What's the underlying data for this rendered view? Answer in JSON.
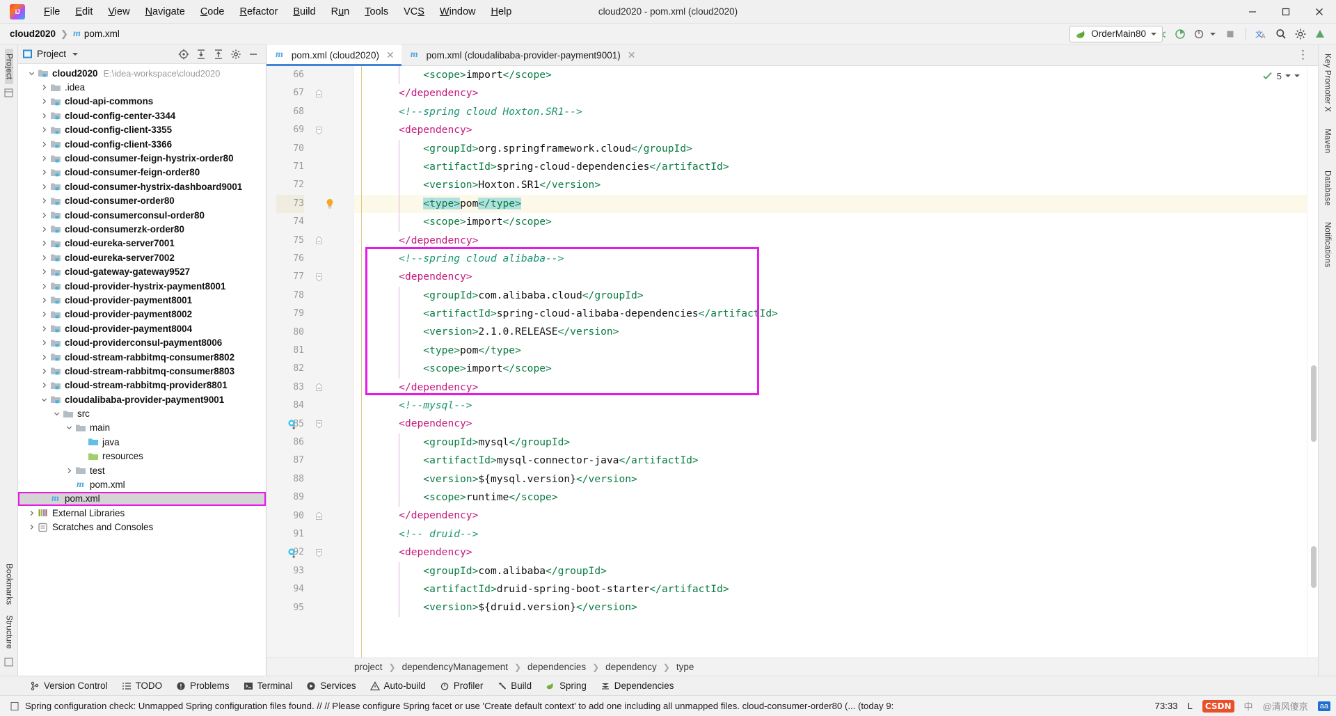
{
  "window": {
    "title": "cloud2020 - pom.xml (cloud2020)",
    "minimize": "minimize-icon",
    "maximize": "maximize-icon",
    "close": "close-icon"
  },
  "menubar": {
    "items": [
      {
        "label": "File",
        "mnemonic": "F"
      },
      {
        "label": "Edit",
        "mnemonic": "E"
      },
      {
        "label": "View",
        "mnemonic": "V"
      },
      {
        "label": "Navigate",
        "mnemonic": "N"
      },
      {
        "label": "Code",
        "mnemonic": "C"
      },
      {
        "label": "Refactor",
        "mnemonic": "R"
      },
      {
        "label": "Build",
        "mnemonic": "B"
      },
      {
        "label": "Run",
        "mnemonic": "u"
      },
      {
        "label": "Tools",
        "mnemonic": "T"
      },
      {
        "label": "VCS",
        "mnemonic": "S"
      },
      {
        "label": "Window",
        "mnemonic": "W"
      },
      {
        "label": "Help",
        "mnemonic": "H"
      }
    ]
  },
  "navbar": {
    "project": "cloud2020",
    "file": "pom.xml",
    "run_config": "OrderMain80",
    "icons": [
      "user-dropdown-icon",
      "hammer-icon",
      "run-icon",
      "debug-icon",
      "run-with-coverage-icon",
      "profiler-icon",
      "stop-icon",
      "translate-icon",
      "search-icon",
      "settings-icon",
      "updates-icon"
    ]
  },
  "left_strip": {
    "top_label": "Project",
    "bottom_labels": [
      "Bookmarks",
      "Structure"
    ]
  },
  "right_strip": {
    "labels": [
      "Key Promoter X",
      "Maven",
      "Database",
      "Notifications"
    ]
  },
  "project_panel": {
    "title": "Project",
    "toolbar_icons": [
      "locate-icon",
      "expand-all-icon",
      "collapse-all-icon",
      "settings-icon",
      "hide-icon"
    ],
    "tree": [
      {
        "depth": 0,
        "label": "cloud2020",
        "path": "E:\\idea-workspace\\cloud2020",
        "icon": "module-icon",
        "state": "expanded",
        "bold": true
      },
      {
        "depth": 1,
        "label": ".idea",
        "icon": "folder-icon",
        "state": "collapsed",
        "bold": false
      },
      {
        "depth": 1,
        "label": "cloud-api-commons",
        "icon": "module-icon",
        "state": "collapsed",
        "bold": true
      },
      {
        "depth": 1,
        "label": "cloud-config-center-3344",
        "icon": "module-icon",
        "state": "collapsed",
        "bold": true
      },
      {
        "depth": 1,
        "label": "cloud-config-client-3355",
        "icon": "module-icon",
        "state": "collapsed",
        "bold": true
      },
      {
        "depth": 1,
        "label": "cloud-config-client-3366",
        "icon": "module-icon",
        "state": "collapsed",
        "bold": true
      },
      {
        "depth": 1,
        "label": "cloud-consumer-feign-hystrix-order80",
        "icon": "module-icon",
        "state": "collapsed",
        "bold": true
      },
      {
        "depth": 1,
        "label": "cloud-consumer-feign-order80",
        "icon": "module-icon",
        "state": "collapsed",
        "bold": true
      },
      {
        "depth": 1,
        "label": "cloud-consumer-hystrix-dashboard9001",
        "icon": "module-icon",
        "state": "collapsed",
        "bold": true
      },
      {
        "depth": 1,
        "label": "cloud-consumer-order80",
        "icon": "module-icon",
        "state": "collapsed",
        "bold": true
      },
      {
        "depth": 1,
        "label": "cloud-consumerconsul-order80",
        "icon": "module-icon",
        "state": "collapsed",
        "bold": true
      },
      {
        "depth": 1,
        "label": "cloud-consumerzk-order80",
        "icon": "module-icon",
        "state": "collapsed",
        "bold": true
      },
      {
        "depth": 1,
        "label": "cloud-eureka-server7001",
        "icon": "module-icon",
        "state": "collapsed",
        "bold": true
      },
      {
        "depth": 1,
        "label": "cloud-eureka-server7002",
        "icon": "module-icon",
        "state": "collapsed",
        "bold": true
      },
      {
        "depth": 1,
        "label": "cloud-gateway-gateway9527",
        "icon": "module-icon",
        "state": "collapsed",
        "bold": true
      },
      {
        "depth": 1,
        "label": "cloud-provider-hystrix-payment8001",
        "icon": "module-icon",
        "state": "collapsed",
        "bold": true
      },
      {
        "depth": 1,
        "label": "cloud-provider-payment8001",
        "icon": "module-icon",
        "state": "collapsed",
        "bold": true
      },
      {
        "depth": 1,
        "label": "cloud-provider-payment8002",
        "icon": "module-icon",
        "state": "collapsed",
        "bold": true
      },
      {
        "depth": 1,
        "label": "cloud-provider-payment8004",
        "icon": "module-icon",
        "state": "collapsed",
        "bold": true
      },
      {
        "depth": 1,
        "label": "cloud-providerconsul-payment8006",
        "icon": "module-icon",
        "state": "collapsed",
        "bold": true
      },
      {
        "depth": 1,
        "label": "cloud-stream-rabbitmq-consumer8802",
        "icon": "module-icon",
        "state": "collapsed",
        "bold": true
      },
      {
        "depth": 1,
        "label": "cloud-stream-rabbitmq-consumer8803",
        "icon": "module-icon",
        "state": "collapsed",
        "bold": true
      },
      {
        "depth": 1,
        "label": "cloud-stream-rabbitmq-provider8801",
        "icon": "module-icon",
        "state": "collapsed",
        "bold": true
      },
      {
        "depth": 1,
        "label": "cloudalibaba-provider-payment9001",
        "icon": "module-icon",
        "state": "expanded",
        "bold": true
      },
      {
        "depth": 2,
        "label": "src",
        "icon": "folder-icon",
        "state": "expanded",
        "bold": false
      },
      {
        "depth": 3,
        "label": "main",
        "icon": "folder-icon",
        "state": "expanded",
        "bold": false
      },
      {
        "depth": 4,
        "label": "java",
        "icon": "source-folder-icon",
        "state": "leaf",
        "bold": false
      },
      {
        "depth": 4,
        "label": "resources",
        "icon": "resource-folder-icon",
        "state": "leaf",
        "bold": false
      },
      {
        "depth": 3,
        "label": "test",
        "icon": "folder-icon",
        "state": "collapsed",
        "bold": false
      },
      {
        "depth": 3,
        "label": "pom.xml",
        "icon": "maven-file-icon",
        "state": "leaf",
        "bold": false
      },
      {
        "depth": 1,
        "label": "pom.xml",
        "icon": "maven-file-icon",
        "state": "leaf",
        "bold": false,
        "selected": true,
        "outlined": true
      },
      {
        "depth": 0,
        "label": "External Libraries",
        "icon": "libraries-icon",
        "state": "collapsed",
        "bold": false
      },
      {
        "depth": 0,
        "label": "Scratches and Consoles",
        "icon": "scratches-icon",
        "state": "collapsed",
        "bold": false
      }
    ]
  },
  "editor": {
    "tabs": [
      {
        "label": "pom.xml (cloud2020)",
        "active": true,
        "icon": "maven-file-icon"
      },
      {
        "label": "pom.xml (cloudalibaba-provider-payment9001)",
        "active": false,
        "icon": "maven-file-icon"
      }
    ],
    "inspection_count": "5",
    "first_line_number": 66,
    "highlight_line": 73,
    "lines": [
      {
        "n": 66,
        "indent": 8,
        "fold": "none",
        "tokens": [
          {
            "t": "tag",
            "s": "<scope>"
          },
          {
            "t": "txt",
            "s": "import"
          },
          {
            "t": "tag",
            "s": "</scope>"
          }
        ]
      },
      {
        "n": 67,
        "indent": 4,
        "fold": "end",
        "tokens": [
          {
            "t": "tag2",
            "s": "</dependency>"
          }
        ]
      },
      {
        "n": 68,
        "indent": 4,
        "fold": "none",
        "tokens": [
          {
            "t": "cmt",
            "s": "<!--spring cloud Hoxton.SR1-->"
          }
        ]
      },
      {
        "n": 69,
        "indent": 4,
        "fold": "start",
        "tokens": [
          {
            "t": "tag2",
            "s": "<dependency>"
          }
        ]
      },
      {
        "n": 70,
        "indent": 8,
        "fold": "none",
        "tokens": [
          {
            "t": "tag",
            "s": "<groupId>"
          },
          {
            "t": "txt",
            "s": "org.springframework.cloud"
          },
          {
            "t": "tag",
            "s": "</groupId>"
          }
        ]
      },
      {
        "n": 71,
        "indent": 8,
        "fold": "none",
        "tokens": [
          {
            "t": "tag",
            "s": "<artifactId>"
          },
          {
            "t": "txt",
            "s": "spring-cloud-dependencies"
          },
          {
            "t": "tag",
            "s": "</artifactId>"
          }
        ]
      },
      {
        "n": 72,
        "indent": 8,
        "fold": "none",
        "tokens": [
          {
            "t": "tag",
            "s": "<version>"
          },
          {
            "t": "txt",
            "s": "Hoxton.SR1"
          },
          {
            "t": "tag",
            "s": "</version>"
          }
        ]
      },
      {
        "n": 73,
        "indent": 8,
        "fold": "none",
        "mark": "bulb-icon",
        "highlight": true,
        "tokens": [
          {
            "t": "tag sel",
            "s": "<type>"
          },
          {
            "t": "txt",
            "s": "pom"
          },
          {
            "t": "tag sel",
            "s": "</type>"
          }
        ]
      },
      {
        "n": 74,
        "indent": 8,
        "fold": "none",
        "tokens": [
          {
            "t": "tag",
            "s": "<scope>"
          },
          {
            "t": "txt",
            "s": "import"
          },
          {
            "t": "tag",
            "s": "</scope>"
          }
        ]
      },
      {
        "n": 75,
        "indent": 4,
        "fold": "end",
        "tokens": [
          {
            "t": "tag2",
            "s": "</dependency>"
          }
        ]
      },
      {
        "n": 76,
        "indent": 4,
        "fold": "none",
        "tokens": [
          {
            "t": "cmt",
            "s": "<!--spring cloud alibaba-->"
          }
        ]
      },
      {
        "n": 77,
        "indent": 4,
        "fold": "start",
        "tokens": [
          {
            "t": "tag2",
            "s": "<dependency>"
          }
        ]
      },
      {
        "n": 78,
        "indent": 8,
        "fold": "none",
        "tokens": [
          {
            "t": "tag",
            "s": "<groupId>"
          },
          {
            "t": "txt",
            "s": "com.alibaba.cloud"
          },
          {
            "t": "tag",
            "s": "</groupId>"
          }
        ]
      },
      {
        "n": 79,
        "indent": 8,
        "fold": "none",
        "tokens": [
          {
            "t": "tag",
            "s": "<artifactId>"
          },
          {
            "t": "txt",
            "s": "spring-cloud-alibaba-dependencies"
          },
          {
            "t": "tag",
            "s": "</artifactId>"
          }
        ]
      },
      {
        "n": 80,
        "indent": 8,
        "fold": "none",
        "tokens": [
          {
            "t": "tag",
            "s": "<version>"
          },
          {
            "t": "txt",
            "s": "2.1.0.RELEASE"
          },
          {
            "t": "tag",
            "s": "</version>"
          }
        ]
      },
      {
        "n": 81,
        "indent": 8,
        "fold": "none",
        "tokens": [
          {
            "t": "tag",
            "s": "<type>"
          },
          {
            "t": "txt",
            "s": "pom"
          },
          {
            "t": "tag",
            "s": "</type>"
          }
        ]
      },
      {
        "n": 82,
        "indent": 8,
        "fold": "none",
        "tokens": [
          {
            "t": "tag",
            "s": "<scope>"
          },
          {
            "t": "txt",
            "s": "import"
          },
          {
            "t": "tag",
            "s": "</scope>"
          }
        ]
      },
      {
        "n": 83,
        "indent": 4,
        "fold": "end",
        "tokens": [
          {
            "t": "tag2",
            "s": "</dependency>"
          }
        ]
      },
      {
        "n": 84,
        "indent": 4,
        "fold": "none",
        "tokens": [
          {
            "t": "cmt",
            "s": "<!--mysql-->"
          }
        ]
      },
      {
        "n": 85,
        "indent": 4,
        "fold": "start",
        "mark": "bean-icon",
        "tokens": [
          {
            "t": "tag2",
            "s": "<dependency>"
          }
        ]
      },
      {
        "n": 86,
        "indent": 8,
        "fold": "none",
        "tokens": [
          {
            "t": "tag",
            "s": "<groupId>"
          },
          {
            "t": "txt",
            "s": "mysql"
          },
          {
            "t": "tag",
            "s": "</groupId>"
          }
        ]
      },
      {
        "n": 87,
        "indent": 8,
        "fold": "none",
        "tokens": [
          {
            "t": "tag",
            "s": "<artifactId>"
          },
          {
            "t": "txt",
            "s": "mysql-connector-java"
          },
          {
            "t": "tag",
            "s": "</artifactId>"
          }
        ]
      },
      {
        "n": 88,
        "indent": 8,
        "fold": "none",
        "tokens": [
          {
            "t": "tag",
            "s": "<version>"
          },
          {
            "t": "txt",
            "s": "${mysql.version}"
          },
          {
            "t": "tag",
            "s": "</version>"
          }
        ]
      },
      {
        "n": 89,
        "indent": 8,
        "fold": "none",
        "tokens": [
          {
            "t": "tag",
            "s": "<scope>"
          },
          {
            "t": "txt",
            "s": "runtime"
          },
          {
            "t": "tag",
            "s": "</scope>"
          }
        ]
      },
      {
        "n": 90,
        "indent": 4,
        "fold": "end",
        "tokens": [
          {
            "t": "tag2",
            "s": "</dependency>"
          }
        ]
      },
      {
        "n": 91,
        "indent": 4,
        "fold": "none",
        "tokens": [
          {
            "t": "cmt",
            "s": "<!-- druid-->"
          }
        ]
      },
      {
        "n": 92,
        "indent": 4,
        "fold": "start",
        "mark": "bean-icon",
        "tokens": [
          {
            "t": "tag2",
            "s": "<dependency>"
          }
        ]
      },
      {
        "n": 93,
        "indent": 8,
        "fold": "none",
        "tokens": [
          {
            "t": "tag",
            "s": "<groupId>"
          },
          {
            "t": "txt",
            "s": "com.alibaba"
          },
          {
            "t": "tag",
            "s": "</groupId>"
          }
        ]
      },
      {
        "n": 94,
        "indent": 8,
        "fold": "none",
        "tokens": [
          {
            "t": "tag",
            "s": "<artifactId>"
          },
          {
            "t": "txt",
            "s": "druid-spring-boot-starter"
          },
          {
            "t": "tag",
            "s": "</artifactId>"
          }
        ]
      },
      {
        "n": 95,
        "indent": 8,
        "fold": "none",
        "tokens": [
          {
            "t": "tag",
            "s": "<version>"
          },
          {
            "t": "txt",
            "s": "${druid.version}"
          },
          {
            "t": "tag",
            "s": "</version>"
          }
        ]
      }
    ],
    "breadcrumb": [
      "project",
      "dependencyManagement",
      "dependencies",
      "dependency",
      "type"
    ],
    "annotation_color": "#e819e8"
  },
  "bottom_toolbar": {
    "items": [
      {
        "label": "Version Control",
        "icon": "branch-icon"
      },
      {
        "label": "TODO",
        "icon": "list-icon"
      },
      {
        "label": "Problems",
        "icon": "error-icon"
      },
      {
        "label": "Terminal",
        "icon": "terminal-icon"
      },
      {
        "label": "Services",
        "icon": "services-icon"
      },
      {
        "label": "Auto-build",
        "icon": "autobuild-icon"
      },
      {
        "label": "Profiler",
        "icon": "profiler-icon"
      },
      {
        "label": "Build",
        "icon": "hammer-icon"
      },
      {
        "label": "Spring",
        "icon": "spring-leaf-icon"
      },
      {
        "label": "Dependencies",
        "icon": "dependencies-icon"
      }
    ]
  },
  "statusbar": {
    "message": "Spring configuration check: Unmapped Spring configuration files found. // // Please configure Spring facet or use 'Create default context' to add one including all unmapped files. cloud-consumer-order80 (... (today 9:",
    "caret": "73:33",
    "line_sep": "L",
    "csdn": "CSDN",
    "ime": "中",
    "watermark": "@清风傻京",
    "aa": "aa"
  }
}
